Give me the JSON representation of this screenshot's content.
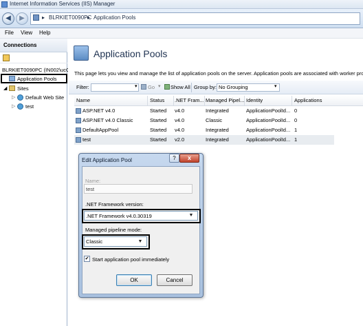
{
  "window": {
    "title": "Internet Information Services (IIS) Manager"
  },
  "address": {
    "crumbs": [
      "BLRKIET0090PC",
      "Application Pools"
    ],
    "sep": "▸"
  },
  "menu": {
    "file": "File",
    "view": "View",
    "help": "Help"
  },
  "connections": {
    "header": "Connections",
    "tree": {
      "server": "BLRKIET0090PC (IN002\\ucC",
      "app_pools": "Application Pools",
      "sites": "Sites",
      "default_site": "Default Web Site",
      "test_site": "test"
    }
  },
  "page": {
    "title": "Application Pools",
    "description": "This page lets you view and manage the list of application pools on the server. Application pools are associated with worker processes, co"
  },
  "filterbar": {
    "filter_label": "Filter:",
    "go": "Go",
    "show_all": "Show All",
    "group_by_label": "Group by:",
    "group_by_value": "No Grouping"
  },
  "grid": {
    "columns": [
      "Name",
      "Status",
      ".NET Fram...",
      "Managed Pipel...",
      "Identity",
      "Applications"
    ],
    "rows": [
      [
        "ASP.NET v4.0",
        "Started",
        "v4.0",
        "Integrated",
        "ApplicationPoolId...",
        "0"
      ],
      [
        "ASP.NET v4.0 Classic",
        "Started",
        "v4.0",
        "Classic",
        "ApplicationPoolId...",
        "0"
      ],
      [
        "DefaultAppPool",
        "Started",
        "v4.0",
        "Integrated",
        "ApplicationPoolId...",
        "1"
      ],
      [
        "test",
        "Started",
        "v2.0",
        "Integrated",
        "ApplicationPoolId...",
        "1"
      ]
    ]
  },
  "dialog": {
    "title": "Edit Application Pool",
    "help": "?",
    "close": "x",
    "name_label": "Name:",
    "name_value": "test",
    "framework_label": ".NET Framework version:",
    "framework_value": ".NET Framework v4.0.30319",
    "pipeline_label": "Managed pipeline mode:",
    "pipeline_value": "Classic",
    "start_immediately_label": "Start application pool immediately",
    "start_immediately_checked": true,
    "ok": "OK",
    "cancel": "Cancel"
  },
  "icons": {
    "back": "back-arrow-icon",
    "forward": "forward-arrow-icon",
    "app_pools": "application-pools-icon"
  },
  "colors": {
    "selection_border": "#000000",
    "header_bg": "#dce6f2"
  }
}
